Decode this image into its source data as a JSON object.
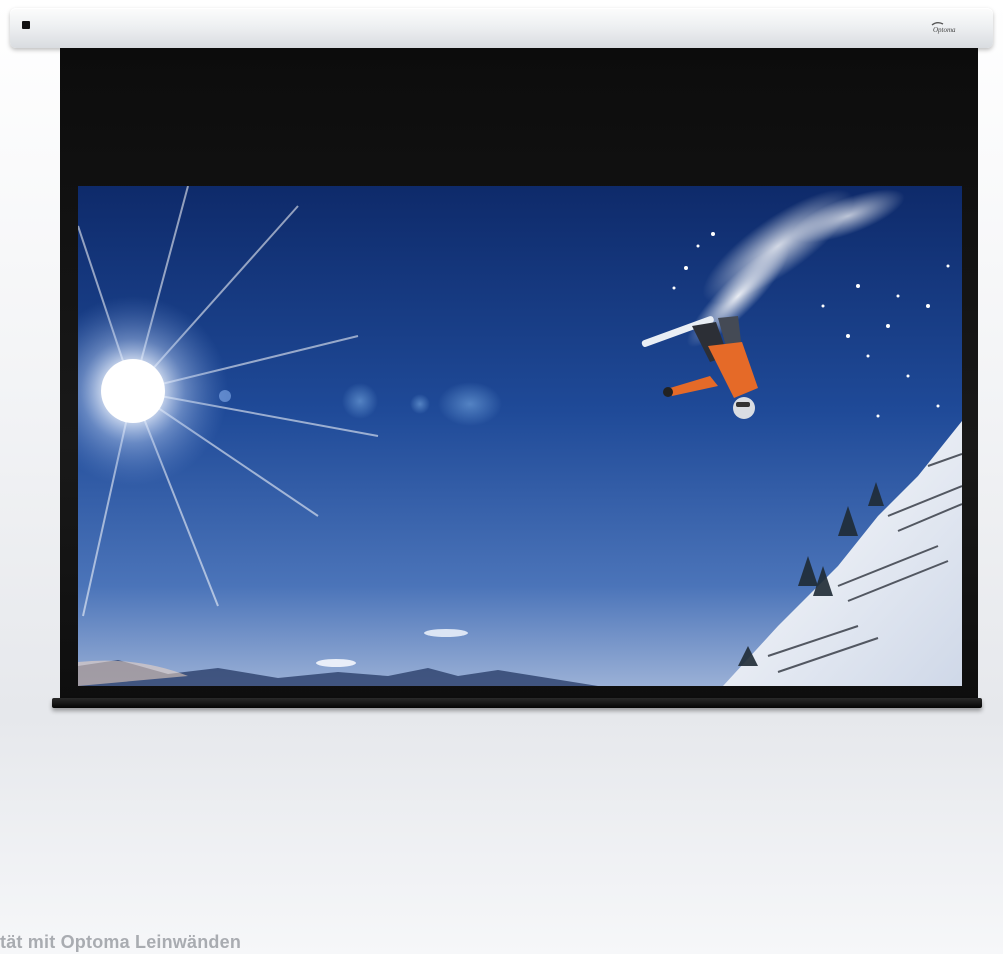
{
  "caption": "tät mit Optoma Leinwänden",
  "brand": {
    "name": "Optoma"
  },
  "scene": {
    "subject": "snowboarder-jump",
    "colors": {
      "sky_top": "#0d2a6e",
      "sky_mid": "#2d5aa8",
      "sky_horizon": "#8fa6cf",
      "sun": "#ffffff",
      "jacket": "#e8672a",
      "snow": "#eef2f8",
      "frame": "#111111"
    }
  }
}
